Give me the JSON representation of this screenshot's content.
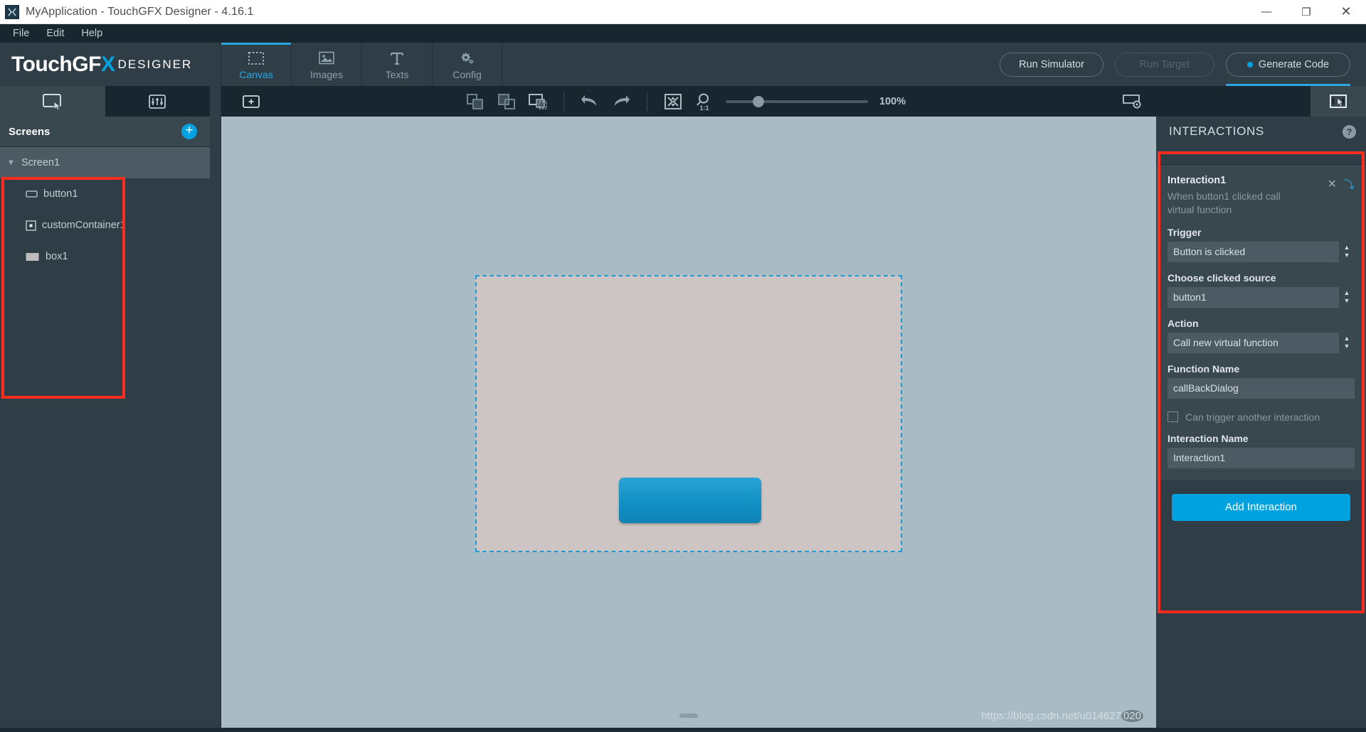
{
  "window": {
    "title": "MyApplication - TouchGFX Designer - 4.16.1",
    "app_icon": "app-icon",
    "minimize": "—",
    "maximize": "❐",
    "close": "✕"
  },
  "menubar": {
    "items": [
      {
        "label": "File"
      },
      {
        "label": "Edit"
      },
      {
        "label": "Help"
      }
    ]
  },
  "brand": {
    "touch": "Touch",
    "gf": "GF",
    "x": "X",
    "designer": "DESIGNER"
  },
  "tabs": [
    {
      "label": "Canvas",
      "icon": "canvas-icon",
      "active": true
    },
    {
      "label": "Images",
      "icon": "images-icon",
      "active": false
    },
    {
      "label": "Texts",
      "icon": "texts-icon",
      "active": false
    },
    {
      "label": "Config",
      "icon": "config-icon",
      "active": false
    }
  ],
  "actions": {
    "run_simulator": "Run Simulator",
    "run_target": "Run Target",
    "generate_code": "Generate Code"
  },
  "left_panel": {
    "tabs": [
      {
        "icon": "screens-tab-icon",
        "active": true
      },
      {
        "icon": "properties-tab-icon",
        "active": false
      }
    ],
    "header_title": "Screens",
    "add_label": "+",
    "tree": [
      {
        "label": "Screen1",
        "icon": "chevron-down-icon",
        "level": 0,
        "selected": true
      },
      {
        "label": "button1",
        "icon": "button-widget-icon",
        "level": 1,
        "selected": false
      },
      {
        "label": "customContainer1",
        "icon": "container-widget-icon",
        "level": 1,
        "selected": false
      },
      {
        "label": "box1",
        "icon": "box-widget-icon",
        "level": 1,
        "selected": false
      }
    ]
  },
  "canvas_toolbar": {
    "add_screen": "+",
    "buttons": [
      {
        "icon": "bring-to-front-icon"
      },
      {
        "icon": "send-to-back-icon"
      },
      {
        "icon": "group-select-icon"
      },
      {
        "icon": "undo-icon"
      },
      {
        "icon": "redo-icon"
      },
      {
        "icon": "fit-to-screen-icon"
      },
      {
        "icon": "zoom-one-to-one-icon"
      }
    ],
    "zoom_label": "1:1",
    "zoom_value": "100%",
    "zoom_percent": 100,
    "right_buttons": [
      {
        "icon": "screen-settings-icon",
        "active": false
      },
      {
        "icon": "interactions-panel-icon",
        "active": true
      }
    ]
  },
  "canvas": {
    "watermark_text": "https://blog.csdn.net/u014627",
    "watermark_tail": "020",
    "screen_bg": "#cdc5c4",
    "selection_color": "#1f9ad6",
    "widget_button_color": "#1190c4"
  },
  "right_panel": {
    "title": "INTERACTIONS",
    "help_glyph": "?",
    "interaction": {
      "name": "Interaction1",
      "description": "When button1 clicked call virtual function",
      "close_glyph": "✕",
      "collapse_glyph": "⤵",
      "trigger_label": "Trigger",
      "trigger_value": "Button is clicked",
      "source_label": "Choose clicked source",
      "source_value": "button1",
      "action_label": "Action",
      "action_value": "Call new virtual function",
      "function_name_label": "Function Name",
      "function_name_value": "callBackDialog",
      "can_trigger_label": "Can trigger another interaction",
      "can_trigger_checked": false,
      "interaction_name_label": "Interaction Name",
      "interaction_name_value": "Interaction1"
    },
    "add_interaction": "Add Interaction"
  },
  "colors": {
    "accent": "#00a3e0",
    "panel": "#2e3d46",
    "panel_dark": "#17262f",
    "card": "#39474f",
    "annotation": "#ff2d20"
  }
}
